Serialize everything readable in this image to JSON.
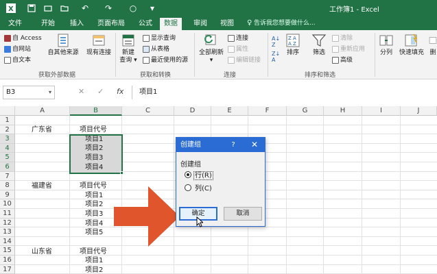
{
  "app": {
    "title": "工作簿1 - Excel",
    "brand_color": "#217346",
    "accent_arrow_color": "#e0552c",
    "dialog_color": "#2b6cd4"
  },
  "quick_access": {
    "save_icon": "save-icon",
    "undo_icon": "undo-icon",
    "redo_icon": "redo-icon"
  },
  "tabs": [
    "文件",
    "开始",
    "插入",
    "页面布局",
    "公式",
    "数据",
    "审阅",
    "视图"
  ],
  "active_tab": "数据",
  "tell_me": "告诉我您想要做什么...",
  "ribbon": {
    "get_external": {
      "items": [
        "自 Access",
        "自网站",
        "自文本"
      ],
      "other_sources": "自其他来源",
      "existing": "现有连接",
      "label": "获取外部数据"
    },
    "get_transform": {
      "new_query_1": "新建",
      "new_query_2": "查询",
      "items": [
        "显示查询",
        "从表格",
        "最近使用的源"
      ],
      "label": "获取和转换"
    },
    "connections": {
      "refresh": "全部刷新",
      "items": [
        "连接",
        "属性",
        "编辑链接"
      ],
      "label": "连接"
    },
    "sort_filter": {
      "sort": "排序",
      "filter": "筛选",
      "items": [
        "清除",
        "重新应用",
        "高级"
      ],
      "label": "排序和筛选"
    },
    "data_tools": {
      "split": "分列",
      "flash_fill": "快速填充",
      "remove": "删"
    }
  },
  "formula_bar": {
    "name_box": "B3",
    "cancel": "✕",
    "enter": "✓",
    "fx": "fx",
    "content": "项目1"
  },
  "columns": [
    "A",
    "B",
    "C",
    "D",
    "E",
    "F",
    "G",
    "H",
    "I",
    "J"
  ],
  "rows": [
    "1",
    "2",
    "3",
    "4",
    "5",
    "6",
    "7",
    "8",
    "9",
    "10",
    "11",
    "12",
    "13",
    "14",
    "15",
    "16",
    "17"
  ],
  "cells": {
    "a2": "广东省",
    "b2": "项目代号",
    "b3": "项目1",
    "b4": "项目2",
    "b5": "项目3",
    "b6": "项目4",
    "a8": "福建省",
    "b8": "项目代号",
    "b9": "项目1",
    "b10": "项目2",
    "b11": "项目3",
    "b12": "项目4",
    "b13": "项目5",
    "a15": "山东省",
    "b15": "项目代号",
    "b16": "项目1",
    "b17": "项目2"
  },
  "dialog": {
    "title": "创建组",
    "help": "?",
    "close": "✕",
    "group_label": "创建组",
    "option_row": "行(R)",
    "option_col": "列(C)",
    "ok": "确定",
    "cancel": "取消"
  }
}
